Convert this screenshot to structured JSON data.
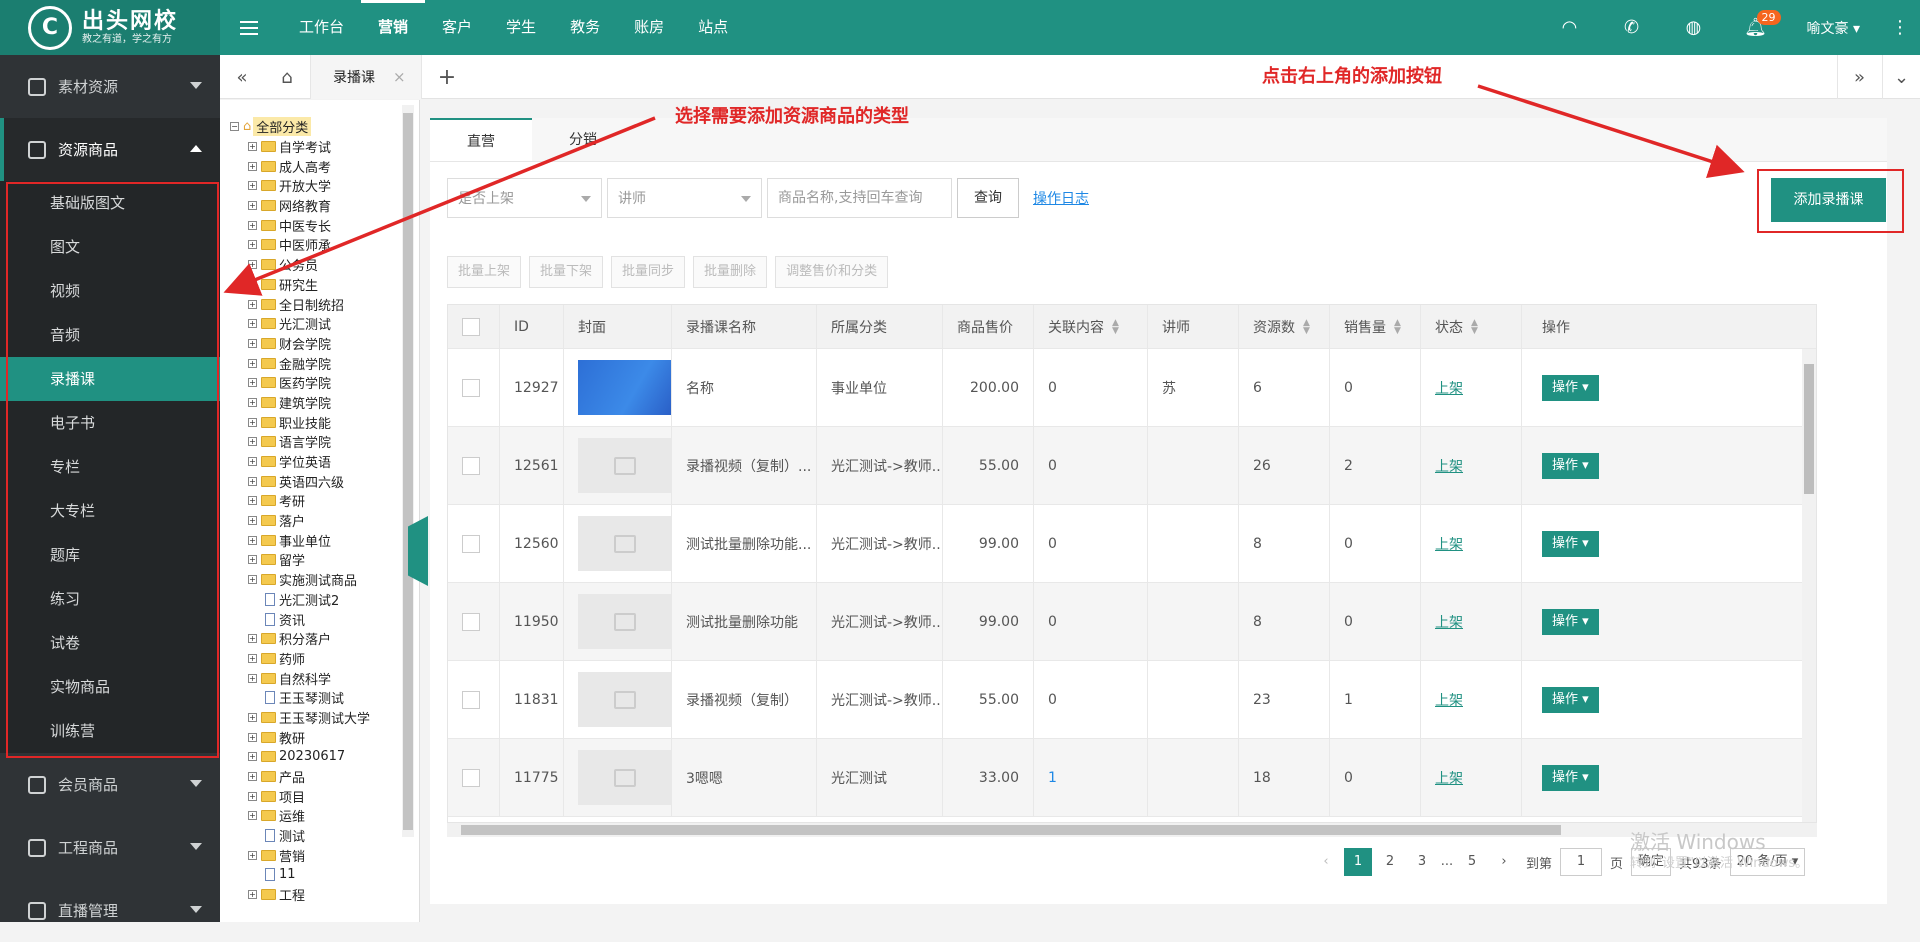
{
  "brand": {
    "name": "出头网校",
    "slogan": "教之有道，学之有方"
  },
  "topnav": [
    "工作台",
    "营销",
    "客户",
    "学生",
    "教务",
    "账房",
    "站点"
  ],
  "topnav_active": 1,
  "notifications": "29",
  "user": "喻文豪",
  "sidebar": {
    "groups": [
      "素材资源",
      "资源商品",
      "会员商品",
      "工程商品",
      "直播管理"
    ],
    "sub_items": [
      "基础版图文",
      "图文",
      "视频",
      "音频",
      "录播课",
      "电子书",
      "专栏",
      "大专栏",
      "题库",
      "练习",
      "试卷",
      "实物商品",
      "训练营"
    ],
    "active_sub": 4
  },
  "tabbar": {
    "current_tab": "录播课",
    "close": "×",
    "add": "+"
  },
  "tree": {
    "root": "全部分类",
    "nodes": [
      {
        "label": "自学考试",
        "type": "folder"
      },
      {
        "label": "成人高考",
        "type": "folder"
      },
      {
        "label": "开放大学",
        "type": "folder"
      },
      {
        "label": "网络教育",
        "type": "folder"
      },
      {
        "label": "中医专长",
        "type": "folder"
      },
      {
        "label": "中医师承",
        "type": "folder"
      },
      {
        "label": "公务员",
        "type": "folder"
      },
      {
        "label": "研究生",
        "type": "folder"
      },
      {
        "label": "全日制统招",
        "type": "folder"
      },
      {
        "label": "光汇测试",
        "type": "folder"
      },
      {
        "label": "财会学院",
        "type": "folder"
      },
      {
        "label": "金融学院",
        "type": "folder"
      },
      {
        "label": "医药学院",
        "type": "folder"
      },
      {
        "label": "建筑学院",
        "type": "folder"
      },
      {
        "label": "职业技能",
        "type": "folder"
      },
      {
        "label": "语言学院",
        "type": "folder"
      },
      {
        "label": "学位英语",
        "type": "folder"
      },
      {
        "label": "英语四六级",
        "type": "folder"
      },
      {
        "label": "考研",
        "type": "folder"
      },
      {
        "label": "落户",
        "type": "folder"
      },
      {
        "label": "事业单位",
        "type": "folder"
      },
      {
        "label": "留学",
        "type": "folder"
      },
      {
        "label": "实施测试商品",
        "type": "folder"
      },
      {
        "label": "光汇测试2",
        "type": "file"
      },
      {
        "label": "资讯",
        "type": "file"
      },
      {
        "label": "积分落户",
        "type": "folder"
      },
      {
        "label": "药师",
        "type": "folder"
      },
      {
        "label": "自然科学",
        "type": "folder"
      },
      {
        "label": "王玉琴测试",
        "type": "file"
      },
      {
        "label": "王玉琴测试大学",
        "type": "folder"
      },
      {
        "label": "教研",
        "type": "folder"
      },
      {
        "label": "20230617",
        "type": "folder"
      },
      {
        "label": "产品",
        "type": "folder"
      },
      {
        "label": "项目",
        "type": "folder"
      },
      {
        "label": "运维",
        "type": "folder"
      },
      {
        "label": "测试",
        "type": "file"
      },
      {
        "label": "营销",
        "type": "folder"
      },
      {
        "label": "11",
        "type": "file"
      },
      {
        "label": "工程",
        "type": "folder"
      }
    ]
  },
  "subtabs": [
    "直营",
    "分销"
  ],
  "filters": {
    "status_placeholder": "是否上架",
    "teacher_placeholder": "讲师",
    "search_placeholder": "商品名称,支持回车查询",
    "query_label": "查询",
    "log_link": "操作日志"
  },
  "add_button": "添加录播课",
  "bulk_actions": [
    "批量上架",
    "批量下架",
    "批量同步",
    "批量删除",
    "调整售价和分类"
  ],
  "table": {
    "columns": [
      "ID",
      "封面",
      "录播课名称",
      "所属分类",
      "商品售价",
      "关联内容",
      "讲师",
      "资源数",
      "销售量",
      "状态",
      "操作"
    ],
    "rows": [
      {
        "id": "12927",
        "name": "名称",
        "category": "事业单位",
        "price": "200.00",
        "related": "0",
        "teacher": "苏",
        "resources": "6",
        "sales": "0",
        "status": "上架",
        "op": "操作"
      },
      {
        "id": "12561",
        "name": "录播视频（复制）...",
        "category": "光汇测试->教师...",
        "price": "55.00",
        "related": "0",
        "teacher": "",
        "resources": "26",
        "sales": "2",
        "status": "上架",
        "op": "操作"
      },
      {
        "id": "12560",
        "name": "测试批量删除功能...",
        "category": "光汇测试->教师...",
        "price": "99.00",
        "related": "0",
        "teacher": "",
        "resources": "8",
        "sales": "0",
        "status": "上架",
        "op": "操作"
      },
      {
        "id": "11950",
        "name": "测试批量删除功能",
        "category": "光汇测试->教师...",
        "price": "99.00",
        "related": "0",
        "teacher": "",
        "resources": "8",
        "sales": "0",
        "status": "上架",
        "op": "操作"
      },
      {
        "id": "11831",
        "name": "录播视频（复制）",
        "category": "光汇测试->教师...",
        "price": "55.00",
        "related": "0",
        "teacher": "",
        "resources": "23",
        "sales": "1",
        "status": "上架",
        "op": "操作"
      },
      {
        "id": "11775",
        "name": "3嗯嗯",
        "category": "光汇测试",
        "price": "33.00",
        "related": "1",
        "teacher": "",
        "resources": "18",
        "sales": "0",
        "status": "上架",
        "op": "操作"
      }
    ]
  },
  "pagination": {
    "pages": [
      "1",
      "2",
      "3",
      "...",
      "5"
    ],
    "goto_label": "到第",
    "goto_value": "1",
    "page_unit": "页",
    "confirm": "确定",
    "total": "共93条",
    "page_size": "20 条/页"
  },
  "annotations": {
    "left": "选择需要添加资源商品的类型",
    "right": "点击右上角的添加按钮"
  },
  "colors": {
    "primary": "#209182",
    "annotation_red": "#e02727",
    "sidebar_bg": "#2f3336"
  },
  "watermark": {
    "line1": "激活 Windows",
    "line2": "转到\"设置\"以激活 Windows。"
  }
}
